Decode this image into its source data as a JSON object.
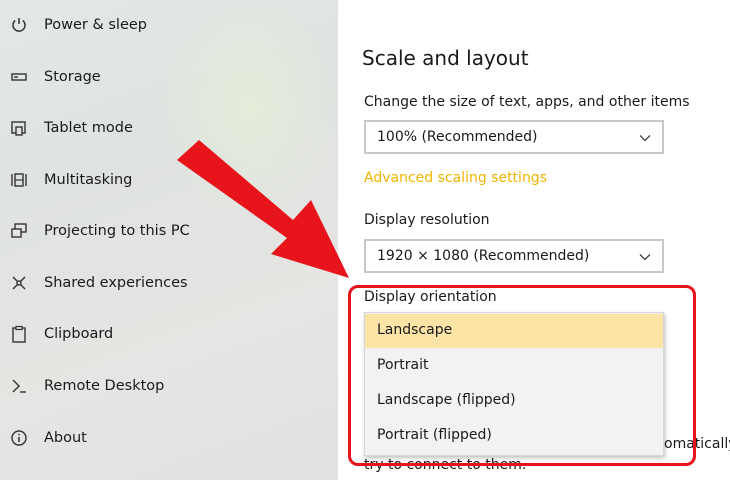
{
  "sidebar": {
    "items": [
      {
        "label": "Power & sleep",
        "icon": "power-icon"
      },
      {
        "label": "Storage",
        "icon": "storage-icon"
      },
      {
        "label": "Tablet mode",
        "icon": "tablet-mode-icon"
      },
      {
        "label": "Multitasking",
        "icon": "multitasking-icon"
      },
      {
        "label": "Projecting to this PC",
        "icon": "projecting-icon"
      },
      {
        "label": "Shared experiences",
        "icon": "shared-experiences-icon"
      },
      {
        "label": "Clipboard",
        "icon": "clipboard-icon"
      },
      {
        "label": "Remote Desktop",
        "icon": "remote-desktop-icon"
      },
      {
        "label": "About",
        "icon": "info-icon"
      }
    ]
  },
  "main": {
    "section_title": "Scale and layout",
    "scale": {
      "label": "Change the size of text, apps, and other items",
      "value": "100% (Recommended)"
    },
    "advanced_link": "Advanced scaling settings",
    "resolution": {
      "label": "Display resolution",
      "value": "1920 × 1080 (Recommended)"
    },
    "orientation": {
      "label": "Display orientation",
      "options": [
        "Landscape",
        "Portrait",
        "Landscape (flipped)",
        "Portrait (flipped)"
      ],
      "selected": "Landscape"
    },
    "partial_text_right": "omatically.",
    "partial_text_bottom": "try to connect to them."
  },
  "colors": {
    "link": "#f0b400",
    "annotation": "#e8141b",
    "selected_option": "#fbe4a6"
  }
}
